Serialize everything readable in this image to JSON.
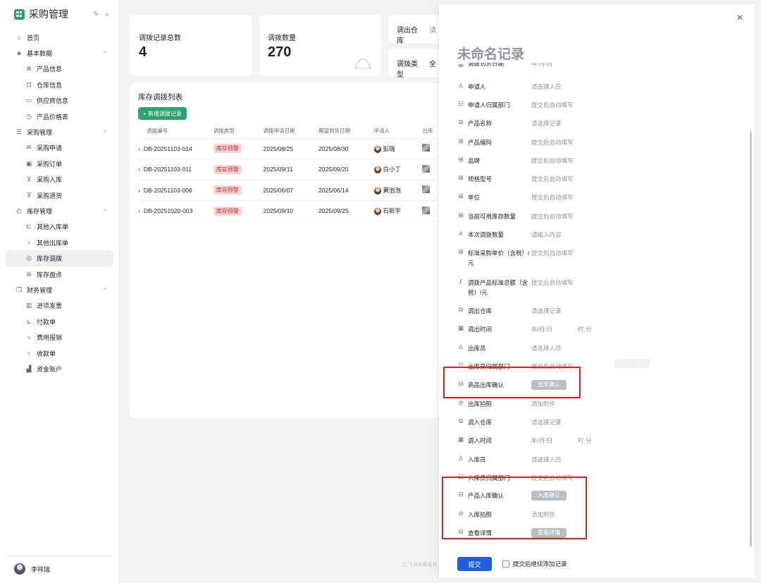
{
  "app": {
    "title": "采购管理"
  },
  "nav": [
    {
      "label": "首页",
      "icon": "home-icon",
      "glyph": "⌂",
      "type": "item"
    },
    {
      "label": "基本数据",
      "icon": "layers-icon",
      "glyph": "◈",
      "type": "group",
      "arrow": "^"
    },
    {
      "label": "产品信息",
      "icon": "globe-icon",
      "glyph": "⊕",
      "type": "child"
    },
    {
      "label": "仓库信息",
      "icon": "warehouse-icon",
      "glyph": "⊡",
      "type": "child"
    },
    {
      "label": "供应商信息",
      "icon": "monitor-icon",
      "glyph": "▭",
      "type": "child"
    },
    {
      "label": "产品价格表",
      "icon": "price-icon",
      "glyph": "◷",
      "type": "child"
    },
    {
      "label": "采购管理",
      "icon": "list-icon",
      "glyph": "☰",
      "type": "group",
      "arrow": "^"
    },
    {
      "label": "采购申请",
      "icon": "mail-icon",
      "glyph": "✉",
      "type": "child"
    },
    {
      "label": "采购订单",
      "icon": "calendar-icon",
      "glyph": "▣",
      "type": "child"
    },
    {
      "label": "采购入库",
      "icon": "inbox-icon",
      "glyph": "⊻",
      "type": "child"
    },
    {
      "label": "采购退货",
      "icon": "return-icon",
      "glyph": "⊼",
      "type": "child"
    },
    {
      "label": "库存管理",
      "icon": "clock-icon",
      "glyph": "◴",
      "type": "group",
      "arrow": "^"
    },
    {
      "label": "其他入库单",
      "icon": "import-icon",
      "glyph": "⊏",
      "type": "child"
    },
    {
      "label": "其他出库单",
      "icon": "export-icon",
      "glyph": "♀",
      "type": "child"
    },
    {
      "label": "库存调拨",
      "icon": "transfer-icon",
      "glyph": "◎",
      "type": "child",
      "active": true
    },
    {
      "label": "库存盘点",
      "icon": "inventory-icon",
      "glyph": "⊛",
      "type": "child"
    },
    {
      "label": "财务管理",
      "icon": "finance-icon",
      "glyph": "❐",
      "type": "group",
      "arrow": "^"
    },
    {
      "label": "进项发票",
      "icon": "barcode-icon",
      "glyph": "▥",
      "type": "child"
    },
    {
      "label": "付款单",
      "icon": "chart-icon",
      "glyph": "⊾",
      "type": "child"
    },
    {
      "label": "费用报销",
      "icon": "trophy-icon",
      "glyph": "♆",
      "type": "child"
    },
    {
      "label": "收款单",
      "icon": "bulb-icon",
      "glyph": "♁",
      "type": "child"
    },
    {
      "label": "资金账户",
      "icon": "bars-icon",
      "glyph": "▟",
      "type": "child"
    }
  ],
  "user": {
    "name": "李祥瑞"
  },
  "stats": {
    "total_label": "调拨记录总数",
    "total_value": "4",
    "qty_label": "调拨数量",
    "qty_value": "270"
  },
  "filters": {
    "out_wh_label": "调出仓库",
    "out_wh_value": "请",
    "type_label": "调拨类型",
    "type_value": "全"
  },
  "list": {
    "title": "库存调拨列表",
    "add_label": "+ 新增调拨记录",
    "columns": [
      "调拨编号",
      "调拨类型",
      "调拨申请日期",
      "期望到货日期",
      "申请人",
      "出库"
    ],
    "rows": [
      {
        "id": "DB-20251103-014",
        "type": "库存预警",
        "apply_date": "2025/08/25",
        "expect_date": "2025/08/30",
        "applicant": "彭瑞"
      },
      {
        "id": "DB-20251103-011",
        "type": "库存预警",
        "apply_date": "2025/09/11",
        "expect_date": "2025/09/20",
        "applicant": "白小丁"
      },
      {
        "id": "DB-20251103-006",
        "type": "库存预警",
        "apply_date": "2025/06/07",
        "expect_date": "2025/06/14",
        "applicant": "黄泡泡"
      },
      {
        "id": "DB-20251020-003",
        "type": "库存预警",
        "apply_date": "2025/09/10",
        "expect_date": "2025/09/25",
        "applicant": "石新宇"
      }
    ]
  },
  "drawer": {
    "title": "未命名记录",
    "top_cut_label": "调拨到货日期",
    "top_cut_value": "年/月/日",
    "fields": [
      {
        "icon": "person-icon",
        "glyph": "♙",
        "label": "申请人",
        "value": "请选择人员"
      },
      {
        "icon": "dept-icon",
        "glyph": "☷",
        "label": "申请人归属部门",
        "value": "提交后自动填写"
      },
      {
        "icon": "link-record-icon",
        "glyph": "⧉",
        "label": "产品名称",
        "value": "请选择记录"
      },
      {
        "icon": "lookup-icon",
        "glyph": "⊞",
        "label": "产品编码",
        "value": "提交后自动填写"
      },
      {
        "icon": "lookup-icon",
        "glyph": "⊞",
        "label": "品牌",
        "value": "提交后自动填写"
      },
      {
        "icon": "lookup-icon",
        "glyph": "⊞",
        "label": "规格型号",
        "value": "提交后自动填写"
      },
      {
        "icon": "lookup-icon",
        "glyph": "⊞",
        "label": "单位",
        "value": "提交后自动填写"
      },
      {
        "icon": "lookup-icon",
        "glyph": "⊞",
        "label": "当前可用库存数量",
        "value": "提交后自动填写"
      },
      {
        "icon": "number-icon",
        "glyph": "#",
        "label": "本次调拨数量",
        "value": "请输入内容"
      },
      {
        "icon": "lookup-icon",
        "glyph": "⊞",
        "label": "标准采购单价（含税）/元",
        "value": "提交后自动填写"
      },
      {
        "icon": "formula-icon",
        "glyph": "ƒ",
        "label": "调拨产品标准总额（含税）/元",
        "value": "提交后自动填写"
      },
      {
        "icon": "link-record-icon",
        "glyph": "⧉",
        "label": "调出仓库",
        "value": "请选择记录"
      },
      {
        "icon": "date-icon",
        "glyph": "▦",
        "label": "调出时间",
        "value": "年/月/日",
        "value2": "时:分"
      },
      {
        "icon": "person-icon",
        "glyph": "♙",
        "label": "出库员",
        "value": "请选择人员"
      },
      {
        "icon": "dept-icon",
        "glyph": "☷",
        "label": "出库员归属部门",
        "value": "提交后自动填写"
      },
      {
        "icon": "button-field-icon",
        "glyph": "⊟",
        "label": "商品出库确认",
        "button": "出库确认"
      },
      {
        "icon": "attachment-icon",
        "glyph": "⊘",
        "label": "出库拍照",
        "value": "添加附件"
      },
      {
        "icon": "link-record-icon",
        "glyph": "⧉",
        "label": "调入仓库",
        "value": "请选择记录"
      },
      {
        "icon": "date-icon",
        "glyph": "▦",
        "label": "调入时间",
        "value": "年/月/日",
        "value2": "时:分"
      },
      {
        "icon": "person-icon",
        "glyph": "♙",
        "label": "入库员",
        "value": "请选择人员"
      },
      {
        "icon": "dept-icon",
        "glyph": "☷",
        "label": "入库员归属部门",
        "value": "提交后自动填写"
      },
      {
        "icon": "button-field-icon",
        "glyph": "⊟",
        "label": "产品入库确认",
        "button": "入库确认"
      },
      {
        "icon": "attachment-icon",
        "glyph": "⊘",
        "label": "入库拍照",
        "value": "添加附件"
      },
      {
        "icon": "button-field-icon",
        "glyph": "⊟",
        "label": "查看详情",
        "button": "查看详情"
      }
    ],
    "submit_label": "提交",
    "continue_label": "提交后继续添加记录"
  },
  "colors": {
    "accent_green": "#2ea36b",
    "primary_blue": "#1f5fe0",
    "tag_red": "#c73131",
    "highlight_red": "#e02020"
  }
}
